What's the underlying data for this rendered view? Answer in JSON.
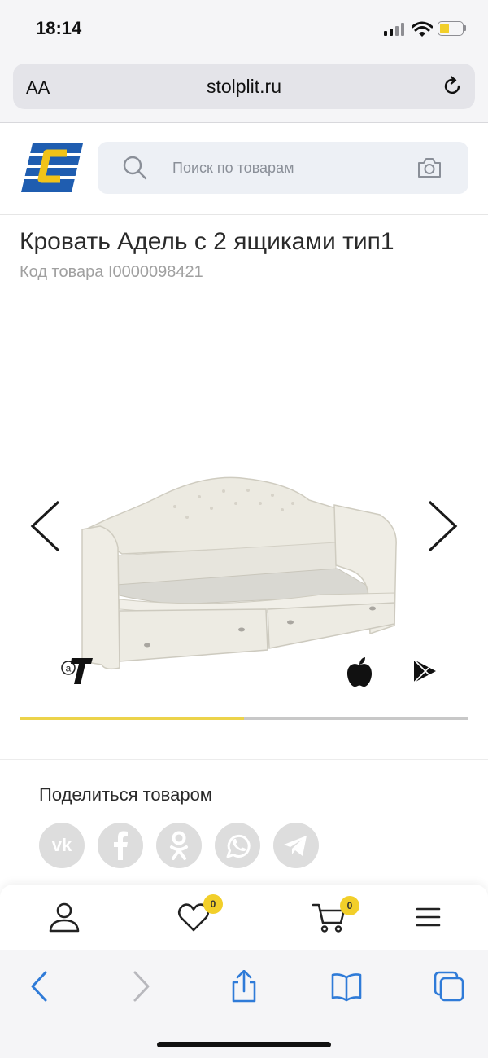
{
  "status_bar": {
    "time": "18:14",
    "battery_color": "#f2cf2a"
  },
  "browser": {
    "text_size_label": "AA",
    "domain": "stolplit.ru"
  },
  "header": {
    "logo_colors": {
      "primary": "#1f5db0",
      "accent": "#f2c318"
    },
    "search_placeholder": "Поиск по товарам"
  },
  "product": {
    "title": "Кровать Адель с 2 ящиками тип1",
    "code": "Код товара I0000098421",
    "gallery": {
      "position": 0.5
    }
  },
  "share": {
    "title": "Поделиться товаром",
    "icons": [
      "vk-icon",
      "facebook-icon",
      "odnoklassniki-icon",
      "whatsapp-icon",
      "telegram-icon"
    ]
  },
  "bottom_nav": {
    "favorites_count": "0",
    "cart_count": "0"
  },
  "safari_toolbar": {
    "icons": [
      "back-icon",
      "forward-icon",
      "share-icon",
      "bookmarks-icon",
      "tabs-icon"
    ]
  },
  "colors": {
    "accent_yellow": "#ecd34a",
    "share_gray": "#dddddd",
    "safari_blue": "#2f7bd8"
  }
}
